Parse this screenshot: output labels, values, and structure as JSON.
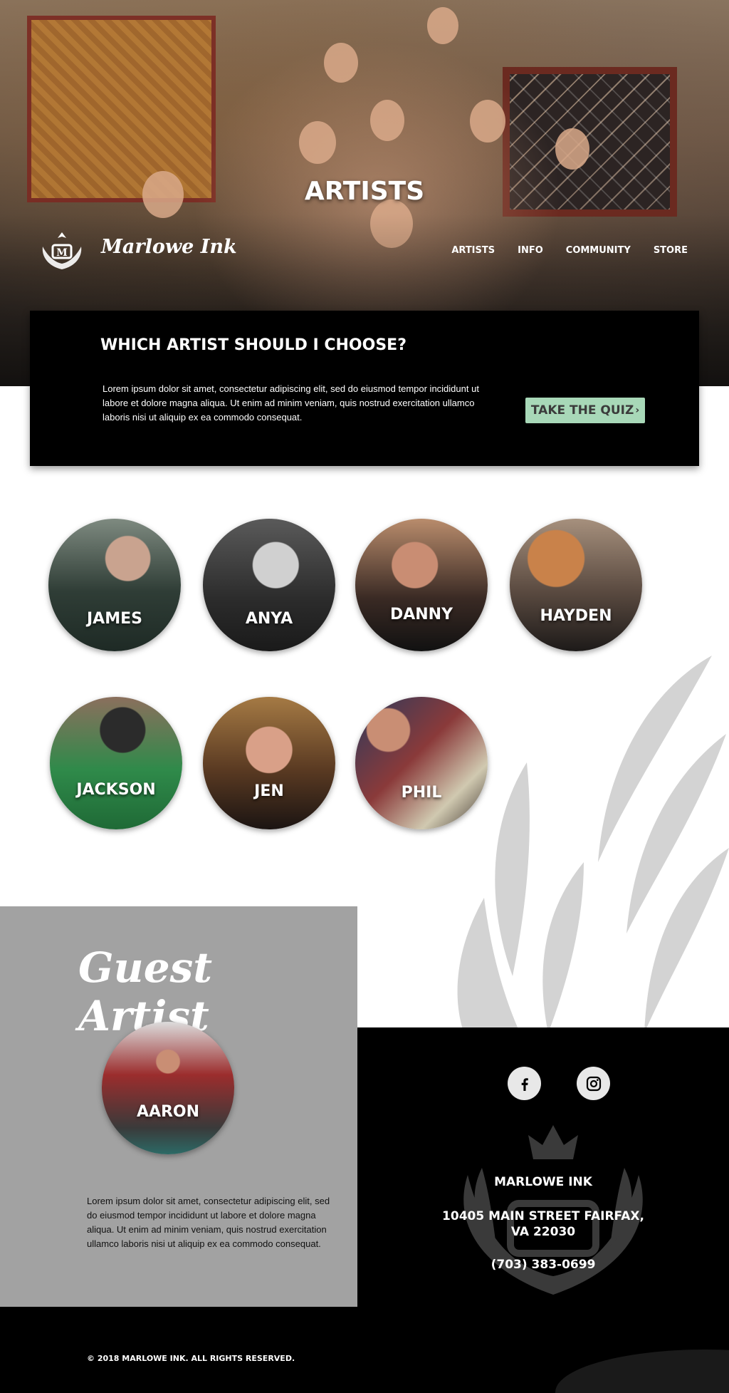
{
  "hero": {
    "title": "ARTISTS"
  },
  "brand": {
    "name": "Marlowe Ink"
  },
  "nav": {
    "items": [
      "ARTISTS",
      "INFO",
      "COMMUNITY",
      "STORE"
    ]
  },
  "quiz": {
    "heading": "WHICH ARTIST SHOULD I CHOOSE?",
    "body": "Lorem ipsum dolor sit amet, consectetur adipiscing elit, sed do eiusmod tempor incididunt ut labore et dolore magna aliqua. Ut enim ad minim veniam, quis nostrud exercitation ullamco laboris nisi ut aliquip ex ea commodo consequat.",
    "button_label": "TAKE THE QUIZ",
    "button_icon": "›"
  },
  "artists": [
    "JAMES",
    "ANYA",
    "DANNY",
    "HAYDEN",
    "JACKSON",
    "JEN",
    "PHIL"
  ],
  "guest": {
    "title": "Guest Artist",
    "artist": "AARON",
    "body": "Lorem ipsum dolor sit amet, consectetur adipiscing elit, sed do eiusmod tempor incididunt ut labore et dolore magna aliqua. Ut enim ad minim veniam, quis nostrud exercitation ullamco laboris nisi ut aliquip ex ea commodo consequat."
  },
  "contact": {
    "name": "MARLOWE INK",
    "address_line1": "10405 MAIN STREET  FAIRFAX,",
    "address_line2": "VA 22030",
    "phone": "(703) 383-0699",
    "social": [
      "facebook-icon",
      "instagram-icon"
    ]
  },
  "footer": {
    "copyright": "© 2018 MARLOWE INK. ALL RIGHTS RESERVED."
  },
  "colors": {
    "accent": "#a8d8b8",
    "panel": "#000000",
    "guest_bg": "#a2a2a2"
  }
}
